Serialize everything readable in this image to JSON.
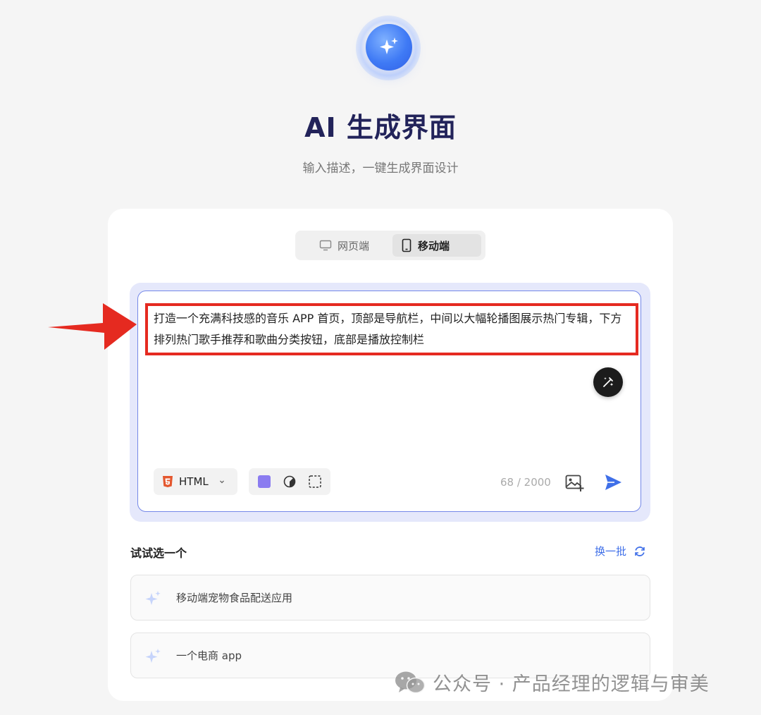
{
  "header": {
    "title": "AI 生成界面",
    "subtitle": "输入描述，一键生成界面设计"
  },
  "platform_toggle": {
    "web_label": "网页端",
    "mobile_label": "移动端",
    "selected": "移动端"
  },
  "prompt": {
    "text": "打造一个充满科技感的音乐 APP 首页，顶部是导航栏，中间以大幅轮播图展示热门专辑，下方排列热门歌手推荐和歌曲分类按钮，底部是播放控制栏",
    "char_count": "68 / 2000"
  },
  "toolbar": {
    "language_label": "HTML",
    "accent_color": "#8b7cf0"
  },
  "suggestions": {
    "section_label": "试试选一个",
    "refresh_label": "换一批",
    "items": [
      {
        "label": "移动端宠物食品配送应用"
      },
      {
        "label": "一个电商 app"
      }
    ]
  },
  "watermark": {
    "text": "公众号 · 产品经理的逻辑与审美"
  },
  "colors": {
    "brand_blue": "#3f6fe8",
    "highlight_red": "#e52a20",
    "input_border": "#7488e8"
  }
}
